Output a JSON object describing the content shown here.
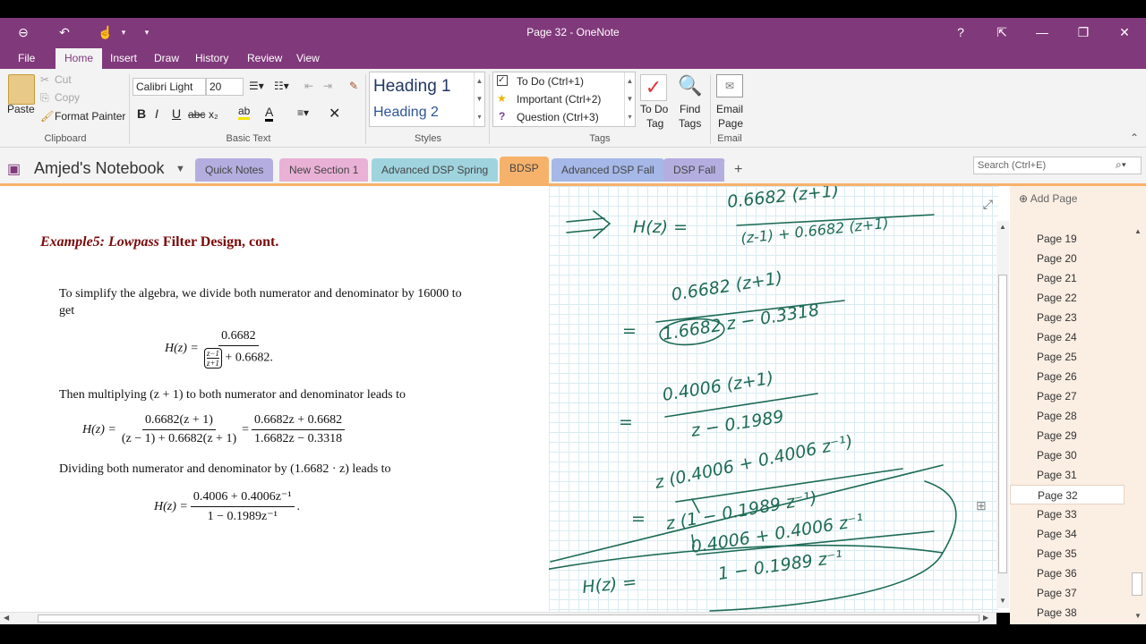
{
  "window": {
    "title": "Page 32 - OneNote"
  },
  "ribbon_tabs": [
    "File",
    "Home",
    "Insert",
    "Draw",
    "History",
    "Review",
    "View"
  ],
  "clipboard": {
    "paste": "Paste",
    "cut": "Cut",
    "copy": "Copy",
    "format_painter": "Format Painter",
    "label": "Clipboard"
  },
  "basic_text": {
    "font": "Calibri Light",
    "size": "20",
    "label": "Basic Text"
  },
  "styles": {
    "h1": "Heading 1",
    "h2": "Heading 2",
    "label": "Styles"
  },
  "tags": {
    "todo": "To Do (Ctrl+1)",
    "important": "Important (Ctrl+2)",
    "question": "Question (Ctrl+3)",
    "todo_tag_1": "To Do",
    "todo_tag_2": "Tag",
    "find_tags_1": "Find",
    "find_tags_2": "Tags",
    "label": "Tags"
  },
  "email": {
    "line1": "Email",
    "line2": "Page",
    "label": "Email"
  },
  "notebook": {
    "name": "Amjed's Notebook"
  },
  "sections": [
    {
      "label": "Quick Notes",
      "color": "#b4aee0"
    },
    {
      "label": "New Section 1",
      "color": "#e9b1d6"
    },
    {
      "label": "Advanced DSP Spring",
      "color": "#9fd4df"
    },
    {
      "label": "BDSP",
      "color": "#f6b26b"
    },
    {
      "label": "Advanced DSP Fall",
      "color": "#a5b8e8"
    },
    {
      "label": "DSP Fall",
      "color": "#b4aee0"
    }
  ],
  "add_section": "+",
  "search": {
    "placeholder": "Search (Ctrl+E)"
  },
  "add_page": "Add Page",
  "pages": [
    "Page 19",
    "Page 20",
    "Page 21",
    "Page 22",
    "Page 23",
    "Page 24",
    "Page 25",
    "Page 26",
    "Page 27",
    "Page 28",
    "Page 29",
    "Page 30",
    "Page 31",
    "Page 32",
    "Page 33",
    "Page 34",
    "Page 35",
    "Page 36",
    "Page 37",
    "Page 38"
  ],
  "selected_page": "Page 32",
  "doc": {
    "title_italic": "Example5: Lowpass",
    "title_rest": " Filter Design, cont.",
    "p1": "To simplify the algebra, we divide both numerator and denominator by 16000 to get",
    "eq1_lhs": "H(z) =",
    "eq1_num": "0.6682",
    "eq1_den_a": "z−1",
    "eq1_den_b": "z+1",
    "eq1_den_c": "+ 0.6682",
    "p2": "Then multiplying (z + 1) to both numerator and denominator leads to",
    "eq2_lhs": "H(z) =",
    "eq2_num1": "0.6682(z + 1)",
    "eq2_den1": "(z − 1) + 0.6682(z + 1)",
    "eq2_eq": "=",
    "eq2_num2": "0.6682z + 0.6682",
    "eq2_den2": "1.6682z − 0.3318",
    "p3": "Dividing both numerator and denominator by (1.6682 · z) leads to",
    "eq3_lhs": "H(z) =",
    "eq3_num": "0.4006 + 0.4006z⁻¹",
    "eq3_den": "1 − 0.1989z⁻¹"
  },
  "ink": {
    "l1_lhs": "H(z) =",
    "l1_num": "0.6682 (z+1)",
    "l1_den": "(z-1) + 0.6682 (z+1)",
    "l2_num": "0.6682 (z+1)",
    "l2_den": "1.6682 z − 0.3318",
    "l3_num": "0.4006 (z+1)",
    "l3_den": "z − 0.1989",
    "l4_num": "z (0.4006 + 0.4006 z⁻¹)",
    "l4_den": "z (1 − 0.1989 z⁻¹)",
    "l5_lhs": "H(z) =",
    "l5_num": "0.4006 + 0.4006 z⁻¹",
    "l5_den": "1 − 0.1989 z⁻¹",
    "eq_sign": "="
  }
}
